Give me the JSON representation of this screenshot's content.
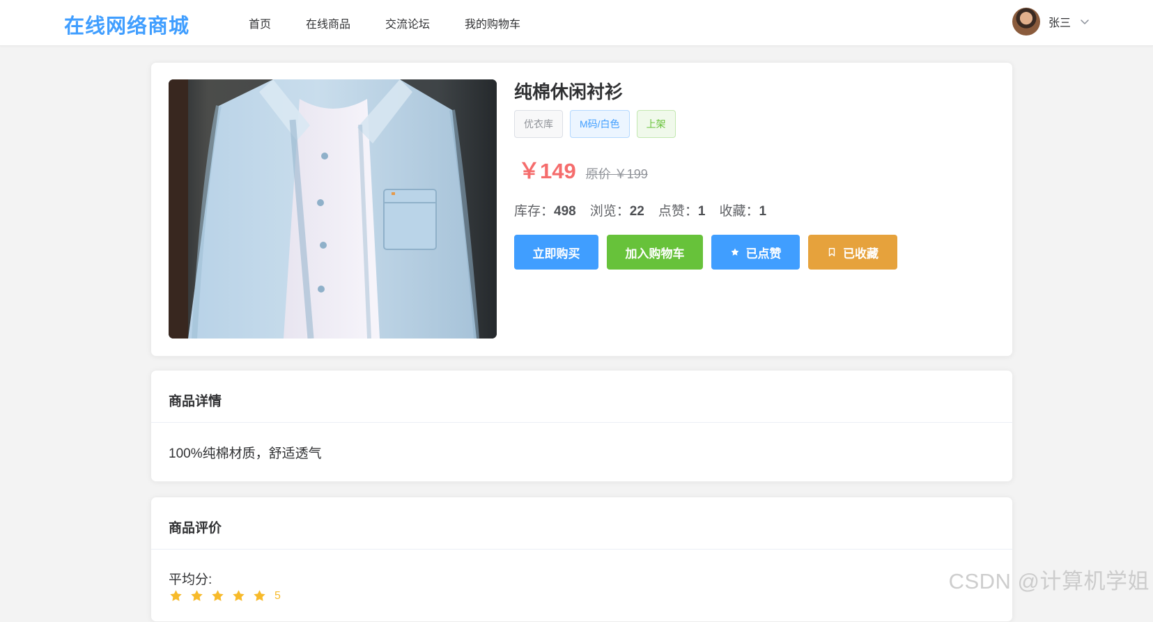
{
  "header": {
    "logo": "在线网络商城",
    "nav": [
      "首页",
      "在线商品",
      "交流论坛",
      "我的购物车"
    ],
    "username": "张三"
  },
  "product": {
    "image_alt": "纯棉休闲衬衫",
    "title": "纯棉休闲衬衫",
    "tags": [
      "优衣库",
      "M码/白色",
      "上架"
    ],
    "price": "￥149",
    "original_price": "原价 ￥199",
    "stats": {
      "stock_label": "库存：",
      "stock_value": "498",
      "views_label": "浏览：",
      "views_value": "22",
      "likes_label": "点赞：",
      "likes_value": "1",
      "favorites_label": "收藏：",
      "favorites_value": "1"
    },
    "actions": {
      "buy": "立即购买",
      "cart": "加入购物车",
      "liked": "已点赞",
      "favorited": "已收藏"
    }
  },
  "details": {
    "title": "商品详情",
    "text": "100%纯棉材质，舒适透气"
  },
  "reviews": {
    "title": "商品评价",
    "average_label": "平均分:",
    "rating": 5,
    "score_text": "5"
  },
  "watermark": "CSDN @计算机学姐",
  "colors": {
    "primary": "#409eff",
    "success": "#67c23a",
    "warning": "#e6a23c",
    "price": "#f56c6c",
    "rating": "#f7ba2a"
  },
  "icons": {
    "dropdown": "chevron-down-icon",
    "liked": "star-icon",
    "favorited": "bookmark-icon",
    "rating": "star-icon"
  }
}
